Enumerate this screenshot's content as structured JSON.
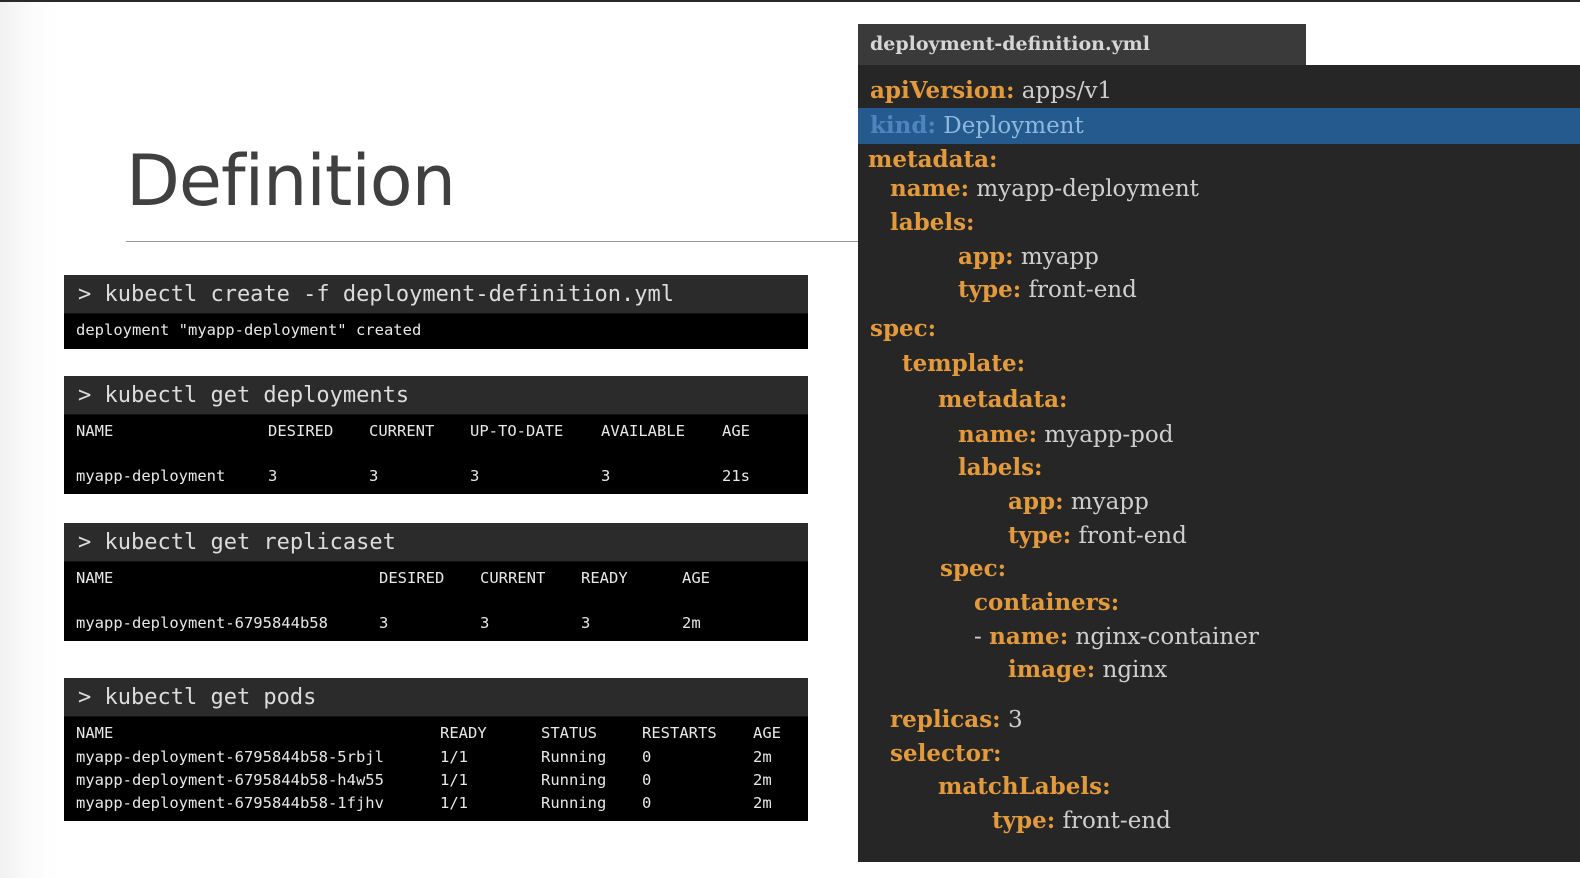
{
  "slide": {
    "title": "Definition"
  },
  "terminals": {
    "create": {
      "command": "> kubectl create -f deployment-definition.yml",
      "output": "deployment \"myapp-deployment\" created"
    },
    "deployments": {
      "command": "> kubectl get deployments",
      "headers": [
        "NAME",
        "DESIRED",
        "CURRENT",
        "UP-TO-DATE",
        "AVAILABLE",
        "AGE"
      ],
      "row": [
        "myapp-deployment",
        "3",
        "3",
        "3",
        "3",
        "21s"
      ]
    },
    "replicaset": {
      "command": "> kubectl get replicaset",
      "headers": [
        "NAME",
        "DESIRED",
        "CURRENT",
        "READY",
        "AGE"
      ],
      "row": [
        "myapp-deployment-6795844b58",
        "3",
        "3",
        "3",
        "2m"
      ]
    },
    "pods": {
      "command": "> kubectl get pods",
      "headers": [
        "NAME",
        "READY",
        "STATUS",
        "RESTARTS",
        "AGE"
      ],
      "rows": [
        [
          "myapp-deployment-6795844b58-5rbjl",
          "1/1",
          "Running",
          "0",
          "2m"
        ],
        [
          "myapp-deployment-6795844b58-h4w55",
          "1/1",
          "Running",
          "0",
          "2m"
        ],
        [
          "myapp-deployment-6795844b58-1fjhv",
          "1/1",
          "Running",
          "0",
          "2m"
        ]
      ]
    }
  },
  "editor": {
    "filename": "deployment-definition.yml",
    "highlight_color": "#245a8e",
    "key_color": "#e39a3c",
    "lines": [
      {
        "key": "apiVersion:",
        "value": "apps/v1"
      },
      {
        "key": "kind:",
        "value": "Deployment",
        "highlighted": true
      },
      {
        "key": "metadata:",
        "value": ""
      },
      {
        "key": "name:",
        "value": "myapp-deployment"
      },
      {
        "key": "labels:",
        "value": ""
      },
      {
        "key": "app:",
        "value": "myapp"
      },
      {
        "key": "type:",
        "value": "front-end"
      },
      {
        "key": "spec:",
        "value": ""
      },
      {
        "key": "template:",
        "value": ""
      },
      {
        "key": "metadata:",
        "value": ""
      },
      {
        "key": "name:",
        "value": "myapp-pod"
      },
      {
        "key": "labels:",
        "value": ""
      },
      {
        "key": "app:",
        "value": "myapp"
      },
      {
        "key": "type:",
        "value": "front-end"
      },
      {
        "key": "spec:",
        "value": ""
      },
      {
        "key": "containers:",
        "value": ""
      },
      {
        "dash": "-",
        "key": "name:",
        "value": "nginx-container"
      },
      {
        "key": "image:",
        "value": "nginx"
      },
      {
        "key": "replicas:",
        "value": "3"
      },
      {
        "key": "selector:",
        "value": ""
      },
      {
        "key": "matchLabels:",
        "value": ""
      },
      {
        "key": "type:",
        "value": "front-end"
      }
    ]
  }
}
